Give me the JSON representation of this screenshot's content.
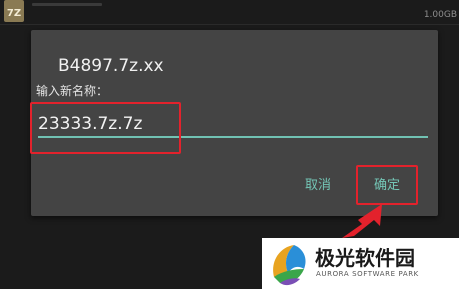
{
  "background_row": {
    "icon_text": "7Z",
    "size_text": "1.00GB"
  },
  "dialog": {
    "title": "B4897.7z.xx",
    "label": "输入新名称：",
    "input_value": "23333.7z.7z",
    "cancel_label": "取消",
    "confirm_label": "确定",
    "accent_color": "#74c6b6"
  },
  "annotation": {
    "highlight_color": "#e3222c"
  },
  "watermark": {
    "name": "极光软件园",
    "subtitle": "AURORA SOFTWARE PARK"
  }
}
